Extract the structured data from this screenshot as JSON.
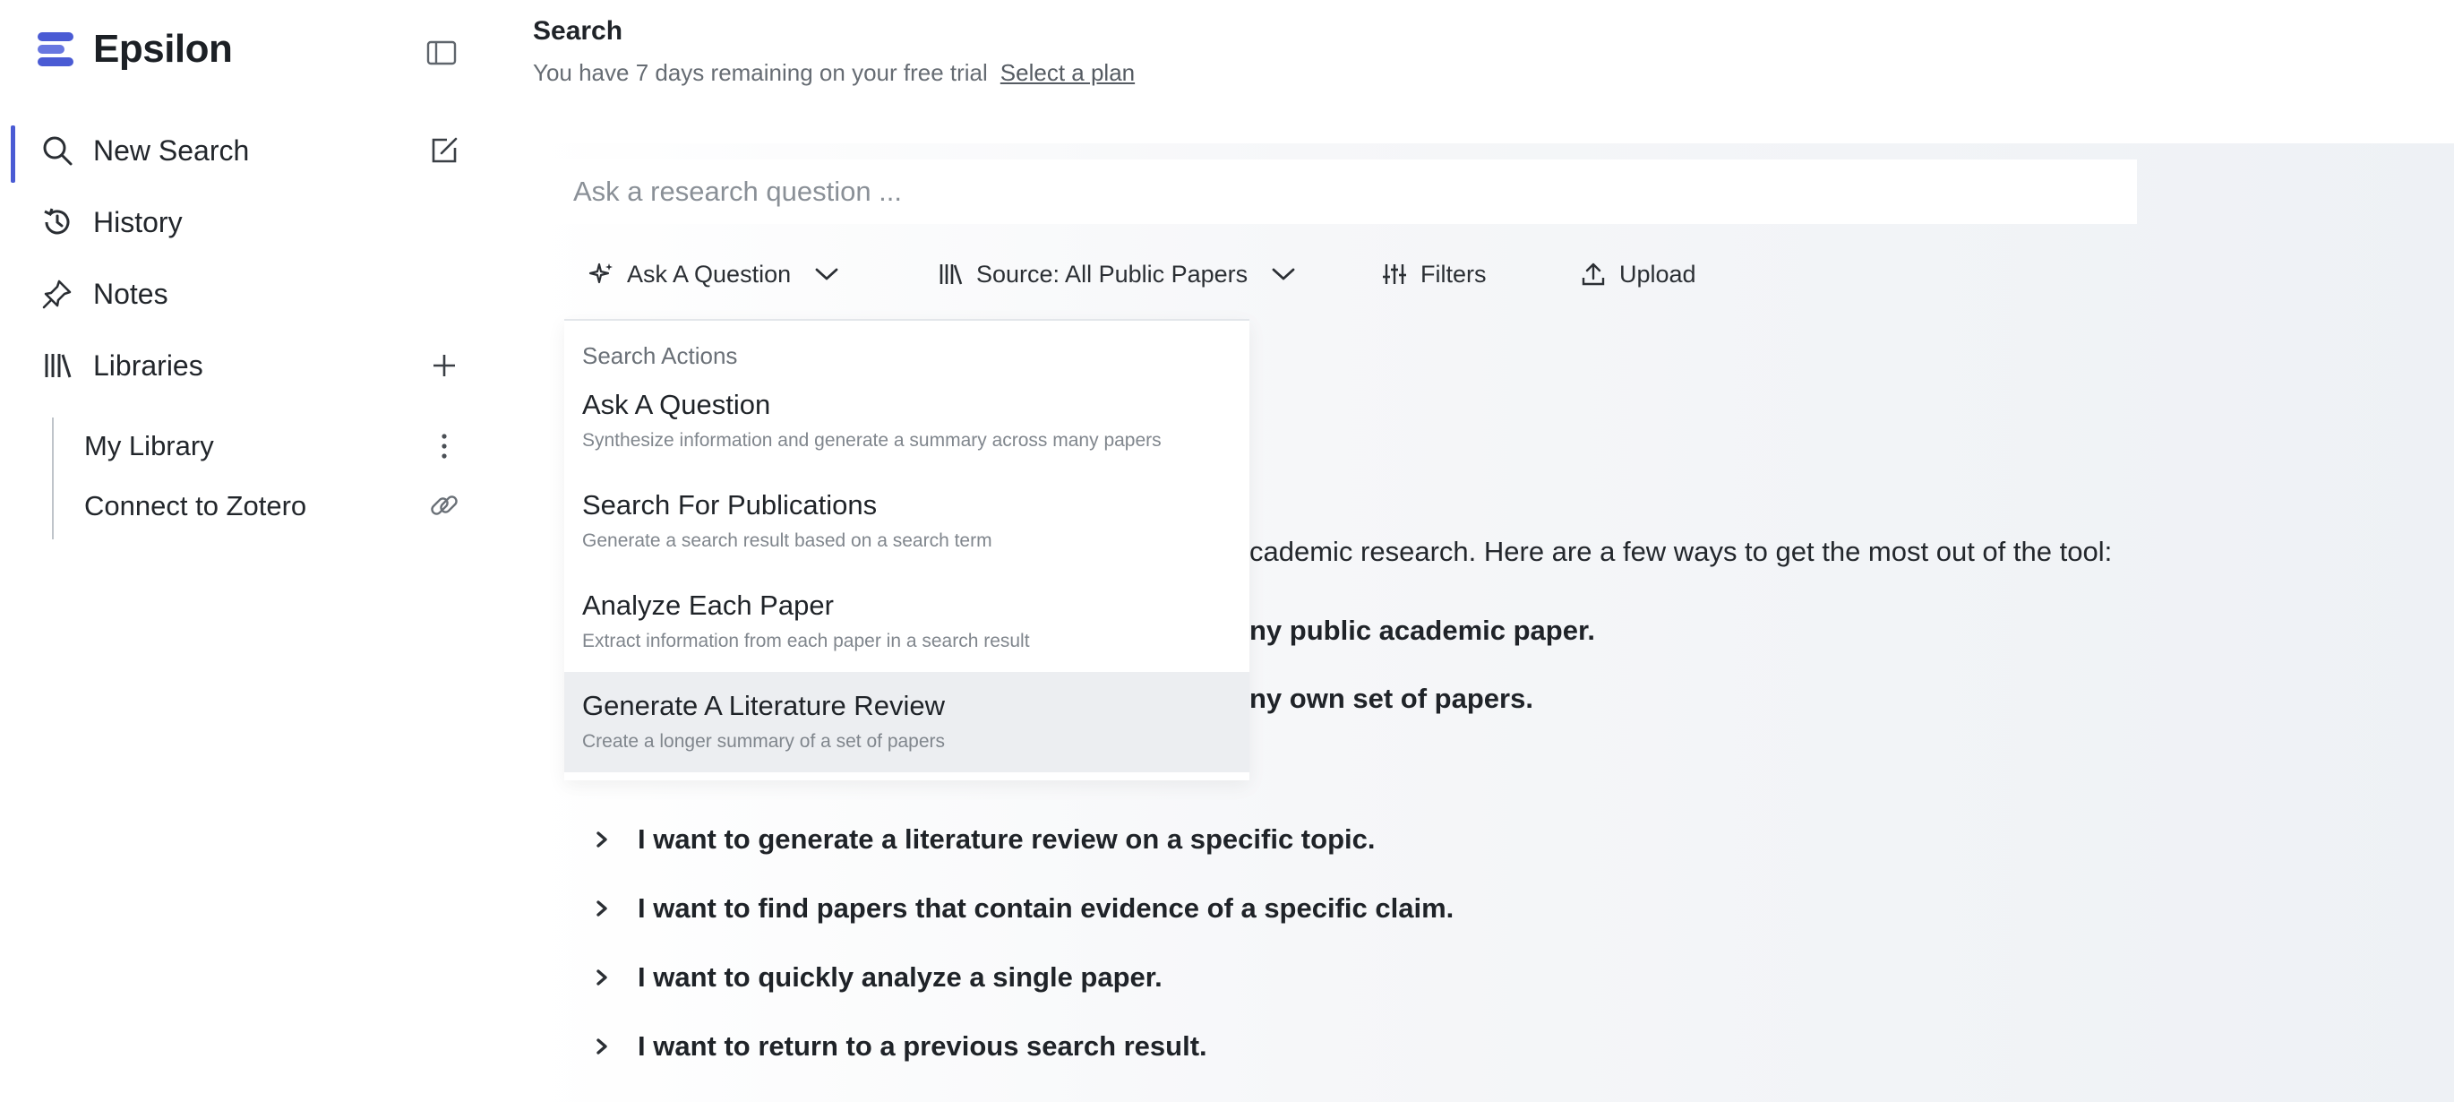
{
  "app": {
    "name": "Epsilon"
  },
  "sidebar": {
    "nav": [
      {
        "label": "New Search",
        "icon": "search-icon"
      },
      {
        "label": "History",
        "icon": "history-icon"
      },
      {
        "label": "Notes",
        "icon": "pin-icon"
      },
      {
        "label": "Libraries",
        "icon": "library-icon"
      }
    ],
    "libraries": [
      {
        "label": "My Library"
      },
      {
        "label": "Connect to Zotero"
      }
    ]
  },
  "header": {
    "title": "Search",
    "trial_text": "You have 7 days remaining on your free trial",
    "trial_link": "Select a plan"
  },
  "search": {
    "placeholder": "Ask a research question ..."
  },
  "toolbar": {
    "mode_label": "Ask A Question",
    "source_label": "Source: All Public Papers",
    "filters_label": "Filters",
    "upload_label": "Upload"
  },
  "dropdown": {
    "header": "Search Actions",
    "items": [
      {
        "title": "Ask A Question",
        "desc": "Synthesize information and generate a summary across many papers"
      },
      {
        "title": "Search For Publications",
        "desc": "Generate a search result based on a search term"
      },
      {
        "title": "Analyze Each Paper",
        "desc": "Extract information from each paper in a search result"
      },
      {
        "title": "Generate A Literature Review",
        "desc": "Create a longer summary of a set of papers"
      }
    ]
  },
  "content": {
    "intro_fragment": "cademic research. Here are a few ways to get the most out of the tool:",
    "bold_fragments": [
      "ny public academic paper.",
      "ny own set of papers."
    ],
    "faqs": [
      "I want to generate a literature review on a specific topic.",
      "I want to find papers that contain evidence of a specific claim.",
      "I want to quickly analyze a single paper.",
      "I want to return to a previous search result."
    ]
  },
  "colors": {
    "accent": "#4a5bd4",
    "highlight_row": "#eceef1"
  }
}
